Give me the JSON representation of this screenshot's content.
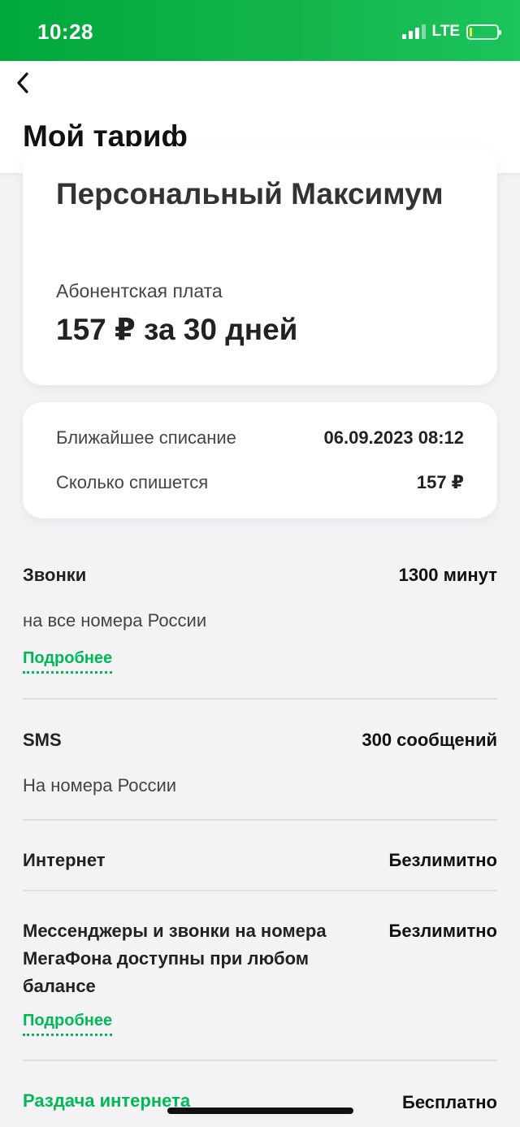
{
  "status_bar": {
    "time": "10:28",
    "network": "LTE",
    "battery_level": 0.1,
    "accent_color": "#00b956"
  },
  "header": {
    "back_icon": "chevron-left-icon",
    "title": "Мой тариф"
  },
  "tariff": {
    "name": "Персональный Максимум",
    "fee_label": "Абонентская плата",
    "fee_value": "157 ₽ за 30 дней"
  },
  "charge": {
    "next_label": "Ближайшее списание",
    "next_value": "06.09.2023 08:12",
    "amount_label": "Сколько спишется",
    "amount_value": "157 ₽"
  },
  "services": {
    "calls": {
      "name": "Звонки",
      "value": "1300 минут",
      "desc": "на все номера России",
      "more": "Подробнее"
    },
    "sms": {
      "name": "SMS",
      "value": "300 сообщений",
      "desc": "На номера России"
    },
    "internet": {
      "name": "Интернет",
      "value": "Безлимитно"
    },
    "messengers": {
      "name": "Мессенджеры и звонки на номера МегаФона доступны при любом балансе",
      "value": "Безлимитно",
      "more": "Подробнее"
    },
    "sharing": {
      "name": "Раздача интернета",
      "value": "Бесплатно"
    }
  }
}
